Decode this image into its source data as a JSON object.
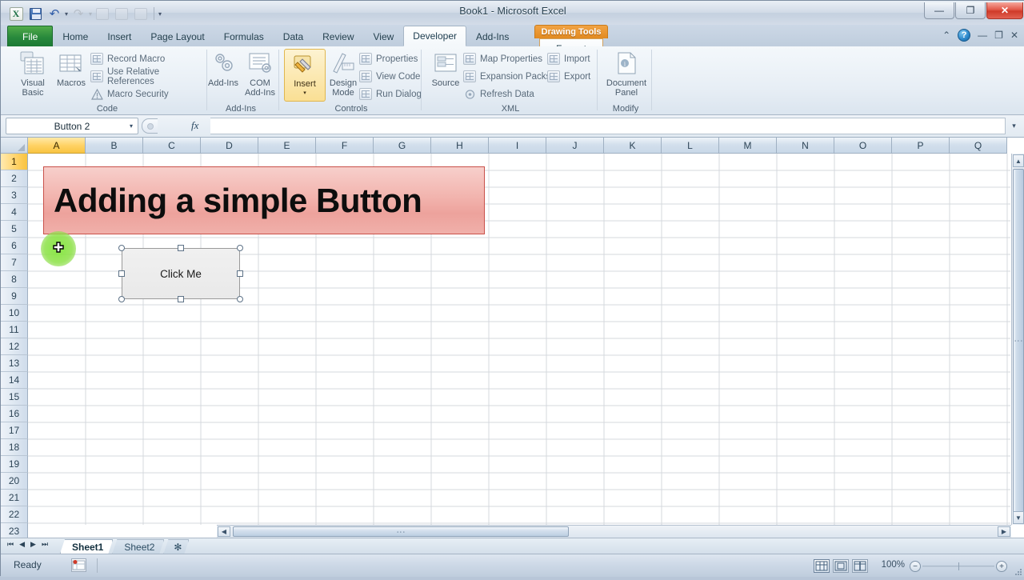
{
  "window": {
    "title": "Book1  -  Microsoft Excel",
    "app_logo": "excel-logo-icon",
    "minimize_label": "—",
    "maximize_label": "❐",
    "close_label": "✕"
  },
  "quick_access": {
    "items": [
      {
        "name": "save-icon",
        "label": "Save"
      },
      {
        "name": "undo-icon",
        "label": "Undo",
        "glyph": "↶"
      },
      {
        "name": "redo-icon",
        "label": "Redo",
        "glyph": "↷"
      },
      {
        "name": "new-icon",
        "label": "New"
      },
      {
        "name": "open-icon",
        "label": "Open"
      },
      {
        "name": "print-preview-icon",
        "label": "Print Preview"
      },
      {
        "name": "customize-qat-icon",
        "label": "Customize Quick Access Toolbar",
        "glyph": "▾"
      }
    ]
  },
  "tabs": {
    "file": "File",
    "items": [
      "Home",
      "Insert",
      "Page Layout",
      "Formulas",
      "Data",
      "Review",
      "View",
      "Developer",
      "Add-Ins"
    ],
    "active": "Developer",
    "contextual": {
      "header": "Drawing Tools",
      "tab": "Format"
    }
  },
  "ribbon_controls": {
    "collapse": "⌃",
    "help": "?",
    "minimize_ribbon": "—",
    "restore_window": "❐",
    "close_window": "✕"
  },
  "ribbon": {
    "groups": [
      {
        "name": "Code",
        "big_buttons": [
          {
            "label_line1": "Visual",
            "label_line2": "Basic",
            "icon": "visual-basic-icon"
          },
          {
            "label_line1": "Macros",
            "label_line2": "",
            "icon": "macros-icon"
          }
        ],
        "small_buttons": [
          {
            "label": "Record Macro",
            "icon": "record-macro-icon"
          },
          {
            "label": "Use Relative References",
            "icon": "relative-references-icon"
          },
          {
            "label": "Macro Security",
            "icon": "macro-security-icon"
          }
        ]
      },
      {
        "name": "Add-Ins",
        "big_buttons": [
          {
            "label_line1": "Add-Ins",
            "label_line2": "",
            "icon": "add-ins-icon"
          },
          {
            "label_line1": "COM",
            "label_line2": "Add-Ins",
            "icon": "com-add-ins-icon"
          }
        ],
        "small_buttons": []
      },
      {
        "name": "Controls",
        "big_buttons": [
          {
            "label_line1": "Insert",
            "label_line2": "▾",
            "icon": "insert-control-icon"
          },
          {
            "label_line1": "Design",
            "label_line2": "Mode",
            "icon": "design-mode-icon"
          }
        ],
        "small_buttons": [
          {
            "label": "Properties",
            "icon": "properties-icon"
          },
          {
            "label": "View Code",
            "icon": "view-code-icon"
          },
          {
            "label": "Run Dialog",
            "icon": "run-dialog-icon"
          }
        ]
      },
      {
        "name": "XML",
        "big_buttons": [
          {
            "label_line1": "Source",
            "label_line2": "",
            "icon": "xml-source-icon"
          }
        ],
        "small_buttons": [
          {
            "label": "Map Properties",
            "icon": "map-properties-icon"
          },
          {
            "label": "Expansion Packs",
            "icon": "expansion-packs-icon"
          },
          {
            "label": "Refresh Data",
            "icon": "refresh-data-icon"
          },
          {
            "label": "Import",
            "icon": "import-icon"
          },
          {
            "label": "Export",
            "icon": "export-icon"
          }
        ]
      },
      {
        "name": "Modify",
        "big_buttons": [
          {
            "label_line1": "Document",
            "label_line2": "Panel",
            "icon": "document-panel-icon"
          }
        ],
        "small_buttons": []
      }
    ]
  },
  "formula_bar": {
    "name_box_value": "Button 2",
    "name_box_caret": "▾",
    "fx_label": "fx",
    "formula_value": "",
    "expand_caret": "▾"
  },
  "grid": {
    "columns": [
      "A",
      "B",
      "C",
      "D",
      "E",
      "F",
      "G",
      "H",
      "I",
      "J",
      "K",
      "L",
      "M",
      "N",
      "O",
      "P",
      "Q"
    ],
    "selected_column": "A",
    "rows": [
      1,
      2,
      3,
      4,
      5,
      6,
      7,
      8,
      9,
      10,
      11,
      12,
      13,
      14,
      15,
      16,
      17,
      18,
      19,
      20,
      21,
      22,
      23
    ],
    "selected_row": 1
  },
  "canvas": {
    "banner_text": "Adding a simple Button",
    "banner_color": "#f0b0aa",
    "banner_border": "#c9514a",
    "button_label": "Click Me",
    "button_selected": true,
    "cursor_type": "crosshair-plus-cursor",
    "cursor_highlight_color": "#8ce64c"
  },
  "sheet_tabs": {
    "nav": [
      "⏮",
      "◀",
      "▶",
      "⏭"
    ],
    "items": [
      "Sheet1",
      "Sheet2"
    ],
    "active": "Sheet1",
    "insert_sheet_label": "✻"
  },
  "status_bar": {
    "mode": "Ready",
    "macro_record_icon": "record-macro-status-icon",
    "views": [
      {
        "name": "normal-view-button",
        "active": true
      },
      {
        "name": "page-layout-view-button",
        "active": false
      },
      {
        "name": "page-break-preview-button",
        "active": false
      }
    ],
    "zoom_level": "100%",
    "zoom_out": "−",
    "zoom_in": "+"
  }
}
